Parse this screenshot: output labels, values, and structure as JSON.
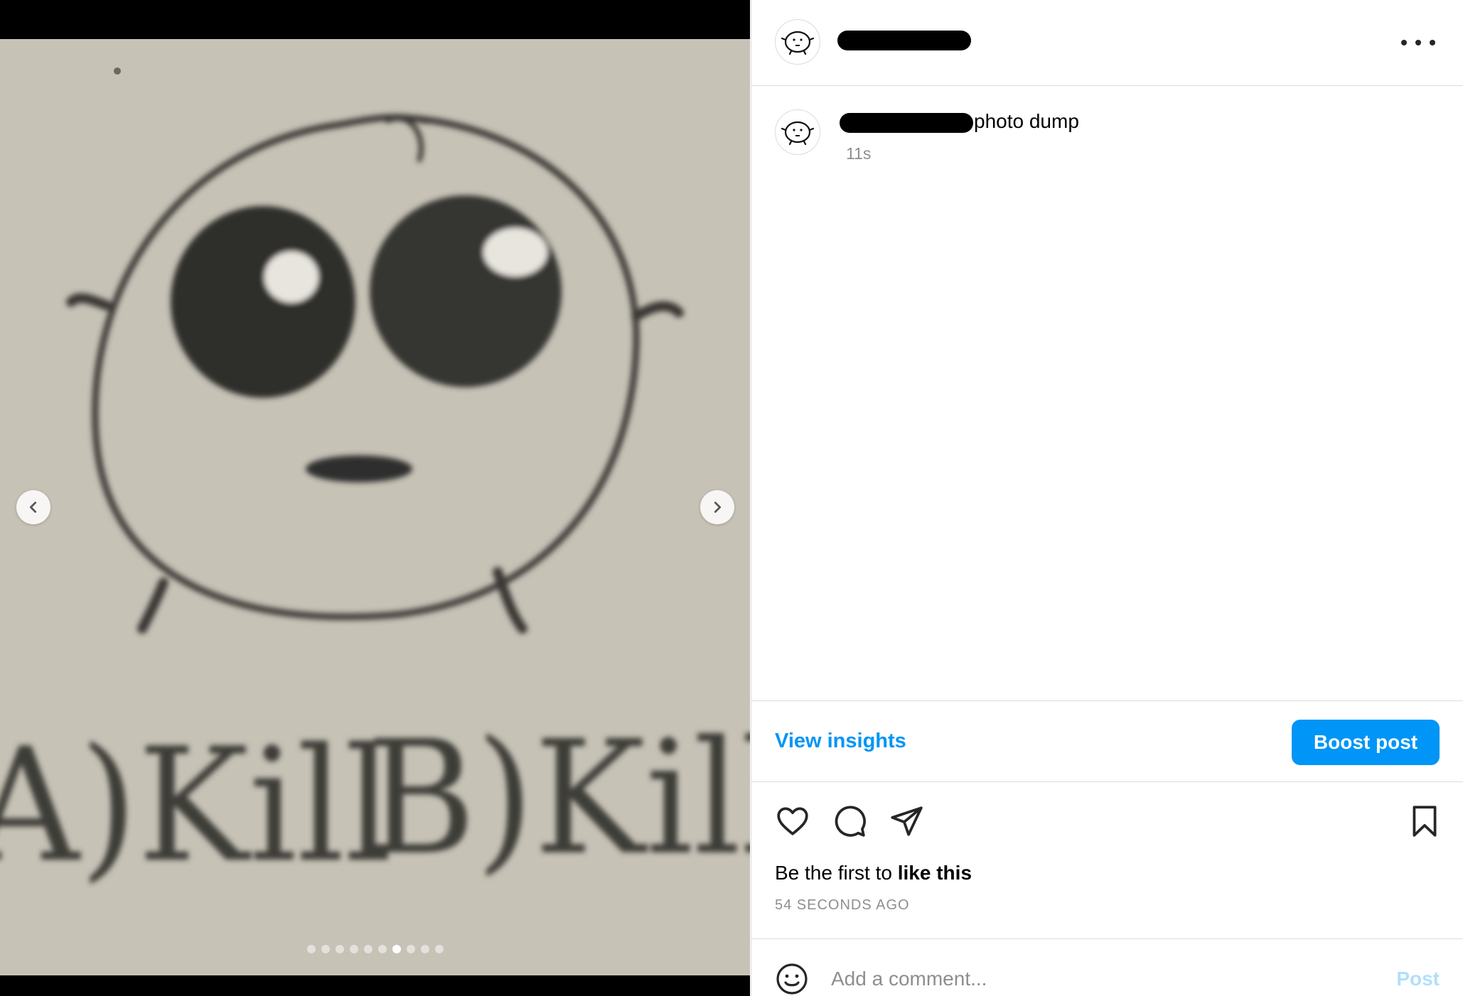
{
  "media": {
    "photo_text_left": "A)Kill",
    "photo_text_right": "B)Kill",
    "carousel": {
      "total": 10,
      "active_index": 6
    },
    "nav": {
      "prev_icon": "chevron-left-icon",
      "next_icon": "chevron-right-icon"
    }
  },
  "header": {
    "avatar_icon": "doodle-face-avatar",
    "username_redacted": true,
    "more_icon": "more-horizontal-icon"
  },
  "caption": {
    "text": "photo dump",
    "time": "11s"
  },
  "insights": {
    "view_label": "View insights",
    "boost_label": "Boost post"
  },
  "actions": {
    "icons": [
      "heart-icon",
      "comment-icon",
      "share-icon",
      "bookmark-icon"
    ],
    "likes_prefix": "Be the first to ",
    "likes_bold": "like this",
    "timestamp": "54 SECONDS AGO"
  },
  "comment": {
    "placeholder": "Add a comment...",
    "post_label": "Post",
    "emoji_icon": "emoji-icon"
  },
  "colors": {
    "accent": "#0095f6",
    "post_disabled": "#b2dffc",
    "muted": "#8e8e8e",
    "divider": "#dbdbdb",
    "paper": "#c7c2b6"
  }
}
